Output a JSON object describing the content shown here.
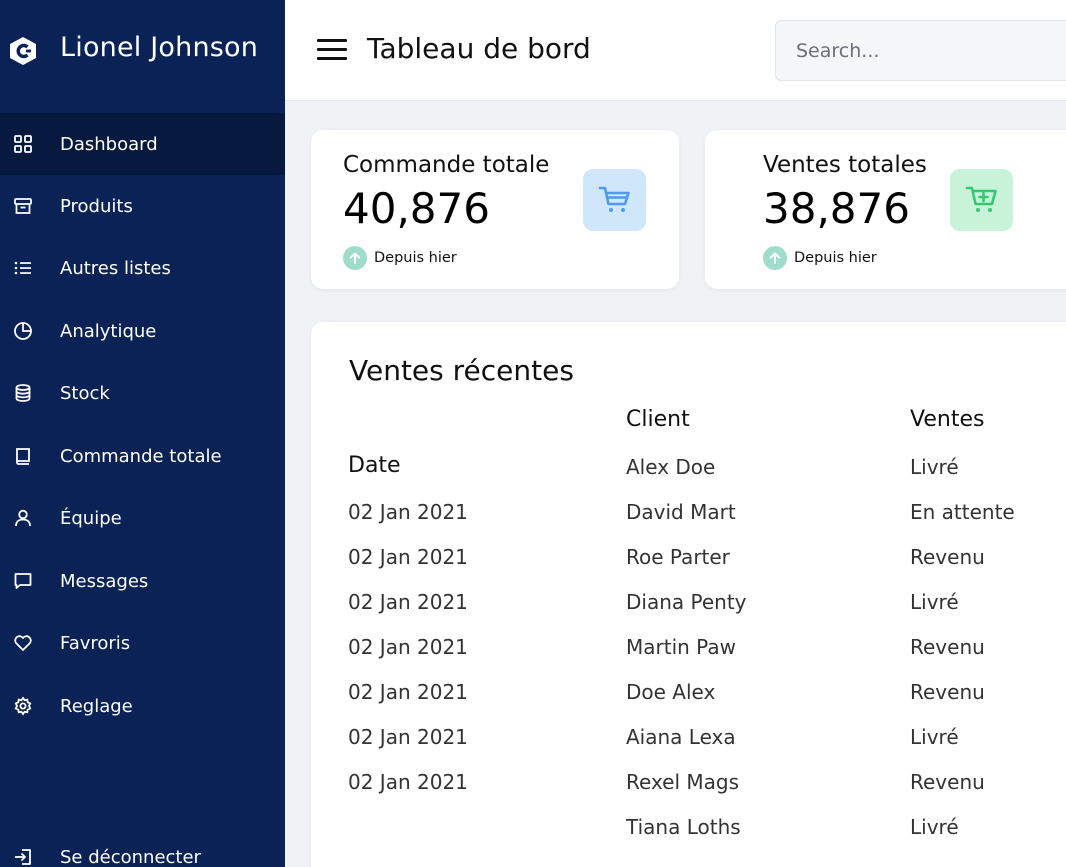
{
  "brand": {
    "name": "Lionel Johnson"
  },
  "sidebar": {
    "items": [
      {
        "label": "Dashboard",
        "icon": "dashboard-grid-icon",
        "active": true
      },
      {
        "label": "Produits",
        "icon": "archive-box-icon"
      },
      {
        "label": "Autres listes",
        "icon": "list-icon"
      },
      {
        "label": "Analytique",
        "icon": "pie-chart-icon"
      },
      {
        "label": "Stock",
        "icon": "database-icon"
      },
      {
        "label": "Commande totale",
        "icon": "book-icon"
      },
      {
        "label": "Équipe",
        "icon": "user-icon"
      },
      {
        "label": "Messages",
        "icon": "message-icon"
      },
      {
        "label": "Favroris",
        "icon": "heart-icon"
      },
      {
        "label": "Reglage",
        "icon": "gear-icon"
      }
    ],
    "logout": {
      "label": "Se déconnecter",
      "icon": "logout-icon"
    }
  },
  "header": {
    "title": "Tableau de bord",
    "search_placeholder": "Search..."
  },
  "stats": [
    {
      "title": "Commande totale",
      "value": "40,876",
      "sub": "Depuis hier",
      "icon": "cart-icon",
      "icon_bg": "#cfe6fb",
      "icon_color": "#4d9bf0"
    },
    {
      "title": "Ventes totales",
      "value": "38,876",
      "sub": "Depuis hier",
      "icon": "cart-plus-icon",
      "icon_bg": "#c9f3d9",
      "icon_color": "#34c873"
    }
  ],
  "sales": {
    "title": "Ventes récentes",
    "headers": {
      "date": "Date",
      "client": "Client",
      "sales": "Ventes"
    },
    "dates": [
      "02 Jan 2021",
      "02 Jan 2021",
      "02 Jan 2021",
      "02 Jan 2021",
      "02 Jan 2021",
      "02 Jan 2021",
      "02 Jan 2021"
    ],
    "clients": [
      "Alex Doe",
      "David Mart",
      "Roe Parter",
      "Diana Penty",
      "Martin Paw",
      "Doe Alex",
      "Aiana Lexa",
      "Rexel Mags",
      "Tiana Loths"
    ],
    "statuses": [
      "Livré",
      "En attente",
      "Revenu",
      "Livré",
      "Revenu",
      "Revenu",
      "Livré",
      "Revenu",
      "Livré"
    ]
  }
}
